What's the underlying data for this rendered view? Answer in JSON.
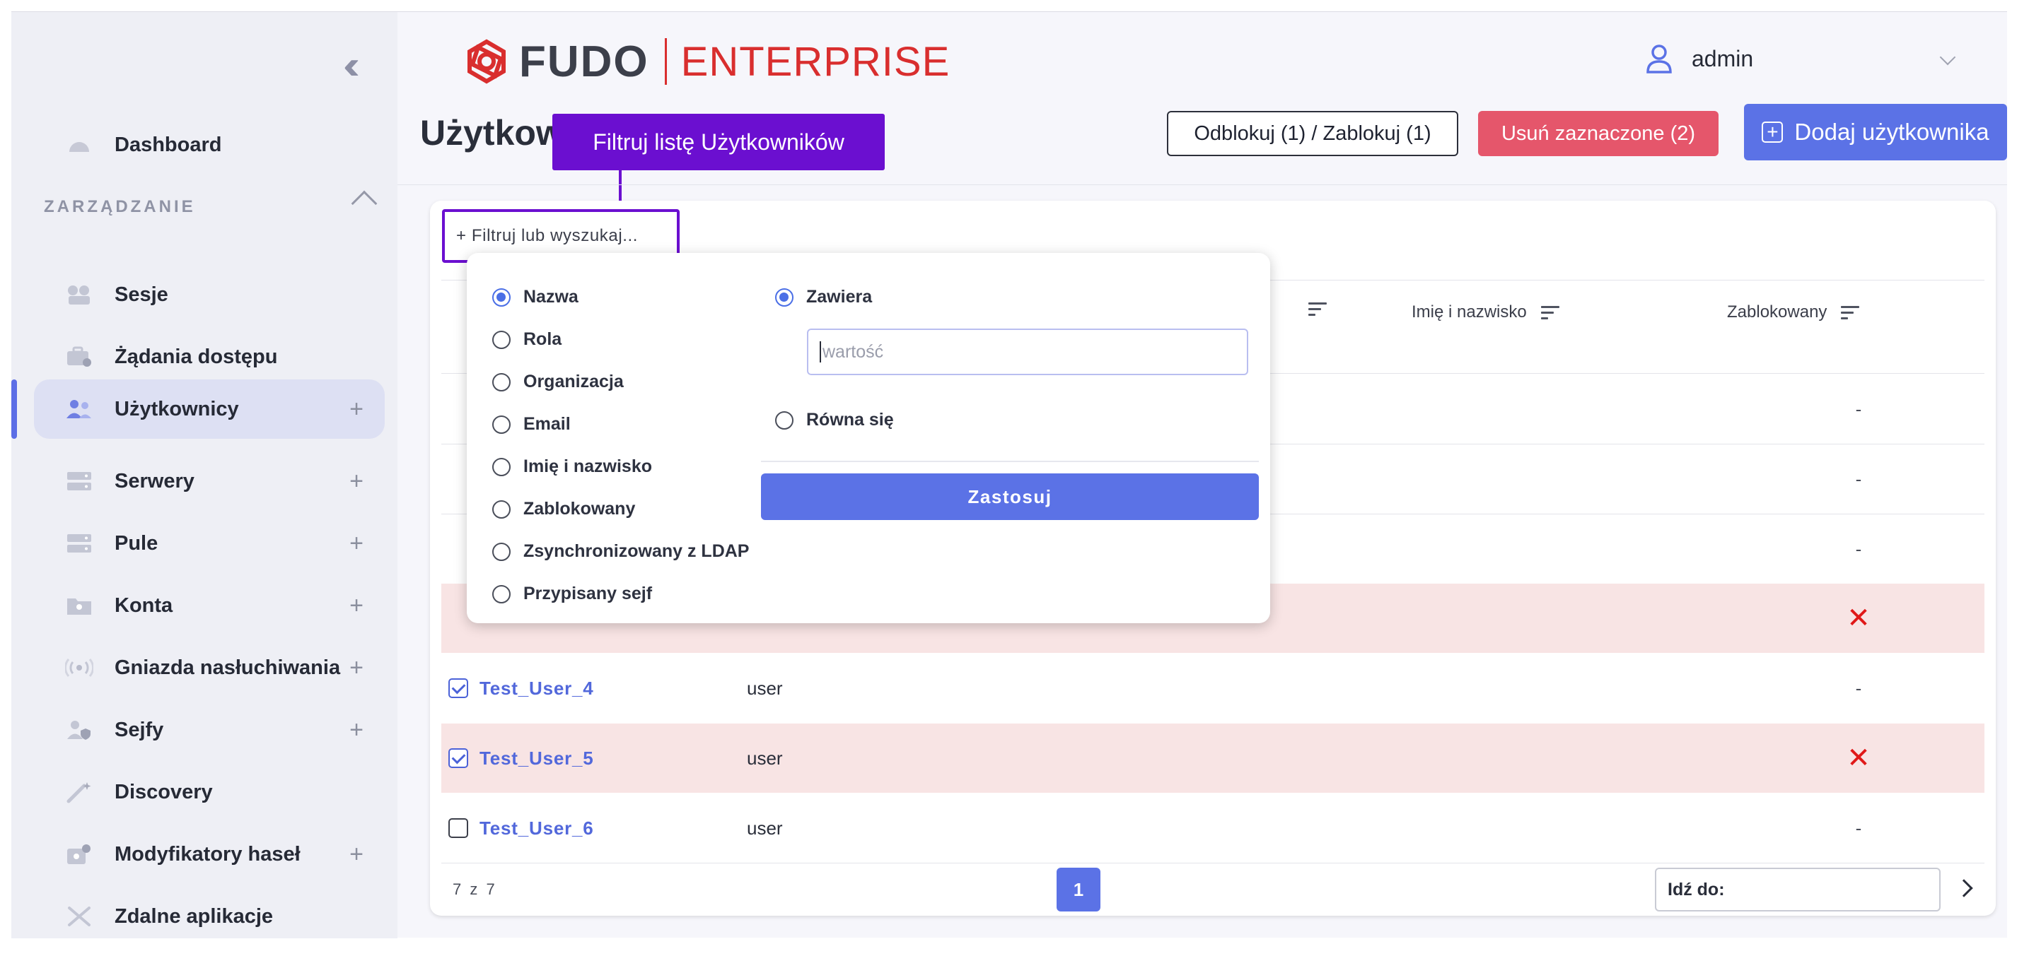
{
  "sidebar": {
    "items": [
      {
        "label": "Dashboard",
        "icon": "dashboard-icon"
      },
      {
        "label": "Sesje",
        "icon": "sessions-icon"
      },
      {
        "label": "Żądania dostępu",
        "icon": "access-requests-icon"
      },
      {
        "label": "Użytkownicy",
        "icon": "users-icon",
        "plus": "+"
      },
      {
        "label": "Serwery",
        "icon": "servers-icon",
        "plus": "+"
      },
      {
        "label": "Pule",
        "icon": "pools-icon",
        "plus": "+"
      },
      {
        "label": "Konta",
        "icon": "accounts-icon",
        "plus": "+"
      },
      {
        "label": "Gniazda nasłuchiwania",
        "icon": "listeners-icon",
        "plus": "+"
      },
      {
        "label": "Sejfy",
        "icon": "safes-icon",
        "plus": "+"
      },
      {
        "label": "Discovery",
        "icon": "discovery-icon"
      },
      {
        "label": "Modyfikatory haseł",
        "icon": "password-changers-icon",
        "plus": "+"
      },
      {
        "label": "Zdalne aplikacje",
        "icon": "remote-apps-icon"
      }
    ],
    "section_label": "ZARZĄDZANIE",
    "active_item": "Użytkownicy"
  },
  "header": {
    "logo_left": "FUDO",
    "logo_right": "ENTERPRISE",
    "user": "admin"
  },
  "page": {
    "title": "Użytkownicy",
    "tooltip": "Filtruj listę Użytkowników",
    "unlock_button": "Odblokuj (1) / Zablokuj (1)",
    "delete_button": "Usuń zaznaczone (2)",
    "add_button": "Dodaj użytkownika"
  },
  "table": {
    "filter_placeholder": "+ Filtruj lub wyszukaj...",
    "columns": {
      "full_name": "Imię i nazwisko",
      "blocked": "Zablokowany"
    },
    "rows_hidden": [
      {
        "blocked": "-"
      },
      {
        "blocked": "-"
      },
      {
        "blocked": "-"
      },
      {
        "blocked": "✕"
      }
    ],
    "rows": [
      {
        "name": "Test_User_4",
        "role": "user",
        "blocked": "-",
        "checked": true
      },
      {
        "name": "Test_User_5",
        "role": "user",
        "blocked": "✕",
        "checked": true
      },
      {
        "name": "Test_User_6",
        "role": "user",
        "blocked": "-",
        "checked": false
      }
    ],
    "count_text": "7 z 7",
    "current_page": "1",
    "goto_label": "Idź do:"
  },
  "filter_dropdown": {
    "fields": [
      "Nazwa",
      "Rola",
      "Organizacja",
      "Email",
      "Imię i nazwisko",
      "Zablokowany",
      "Zsynchronizowany z LDAP",
      "Przypisany sejf"
    ],
    "selected_field": "Nazwa",
    "match_contains": "Zawiera",
    "match_equals": "Równa się",
    "value_placeholder": "wartość",
    "apply_button": "Zastosuj"
  },
  "colors": {
    "accent": "#5b72e6",
    "tooltip": "#6b0fd0",
    "danger": "#e5566b",
    "brand_red": "#d92e2e"
  }
}
